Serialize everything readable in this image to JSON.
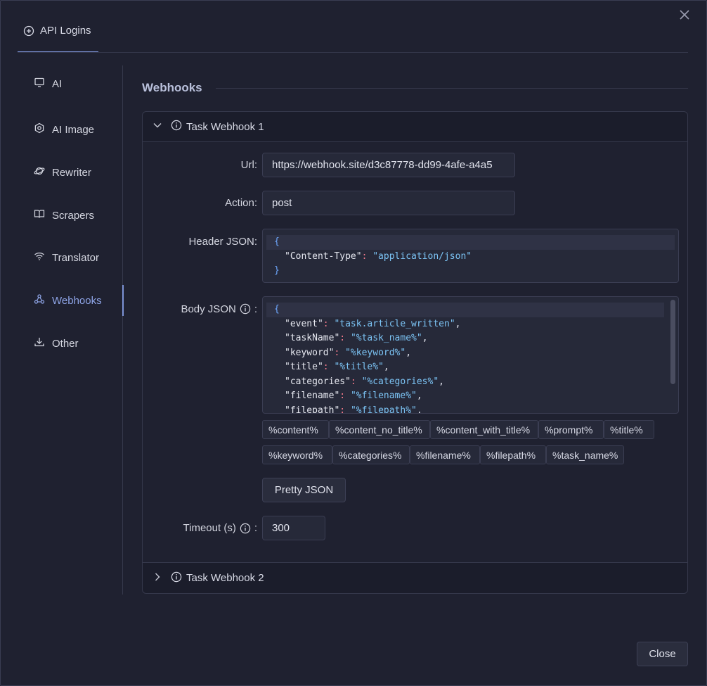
{
  "top_tab": {
    "label": "API Logins",
    "icon": "plus-circle-icon"
  },
  "close_icon": "close-icon",
  "sidebar": {
    "items": [
      {
        "label": "AI",
        "icon": "monitor-icon",
        "active": false
      },
      {
        "label": "AI Image",
        "icon": "gear-icon",
        "active": false
      },
      {
        "label": "Rewriter",
        "icon": "planet-icon",
        "active": false
      },
      {
        "label": "Scrapers",
        "icon": "book-icon",
        "active": false
      },
      {
        "label": "Translator",
        "icon": "wifi-icon",
        "active": false
      },
      {
        "label": "Webhooks",
        "icon": "webhook-icon",
        "active": true
      },
      {
        "label": "Other",
        "icon": "download-icon",
        "active": false
      }
    ]
  },
  "section_title": "Webhooks",
  "webhook1": {
    "title": "Task Webhook 1",
    "url_label": "Url:",
    "url_value": "https://webhook.site/d3c87778-dd99-4afe-a4a5",
    "action_label": "Action:",
    "action_value": "post",
    "header_label": "Header JSON:",
    "header_lines": [
      {
        "open": "{"
      },
      {
        "key": "\"Content-Type\"",
        "value": "\"application/json\"",
        "comma": ""
      },
      {
        "close": "}"
      }
    ],
    "body_label": "Body JSON",
    "body_colon": ":",
    "body_lines": [
      {
        "key": "\"event\"",
        "value": "\"task.article_written\""
      },
      {
        "key": "\"taskName\"",
        "value": "\"%task_name%\""
      },
      {
        "key": "\"keyword\"",
        "value": "\"%keyword%\""
      },
      {
        "key": "\"title\"",
        "value": "\"%title%\""
      },
      {
        "key": "\"categories\"",
        "value": "\"%categories%\""
      },
      {
        "key": "\"filename\"",
        "value": "\"%filename%\""
      },
      {
        "key": "\"filepath\"",
        "value": "\"%filepath%\""
      }
    ],
    "chips_row1": [
      "%content%",
      "%content_no_title%",
      "%content_with_title%",
      "%prompt%",
      "%title%"
    ],
    "chips_row2": [
      "%keyword%",
      "%categories%",
      "%filename%",
      "%filepath%",
      "%task_name%"
    ],
    "pretty_button": "Pretty JSON",
    "timeout_label": "Timeout (s)",
    "timeout_colon": ":",
    "timeout_value": "300"
  },
  "webhook2": {
    "title": "Task Webhook 2"
  },
  "footer": {
    "close_label": "Close"
  },
  "colors": {
    "accent": "#7d93d6",
    "background": "#1f2130",
    "string": "#7cc4f5",
    "colon": "#f27a8a"
  }
}
